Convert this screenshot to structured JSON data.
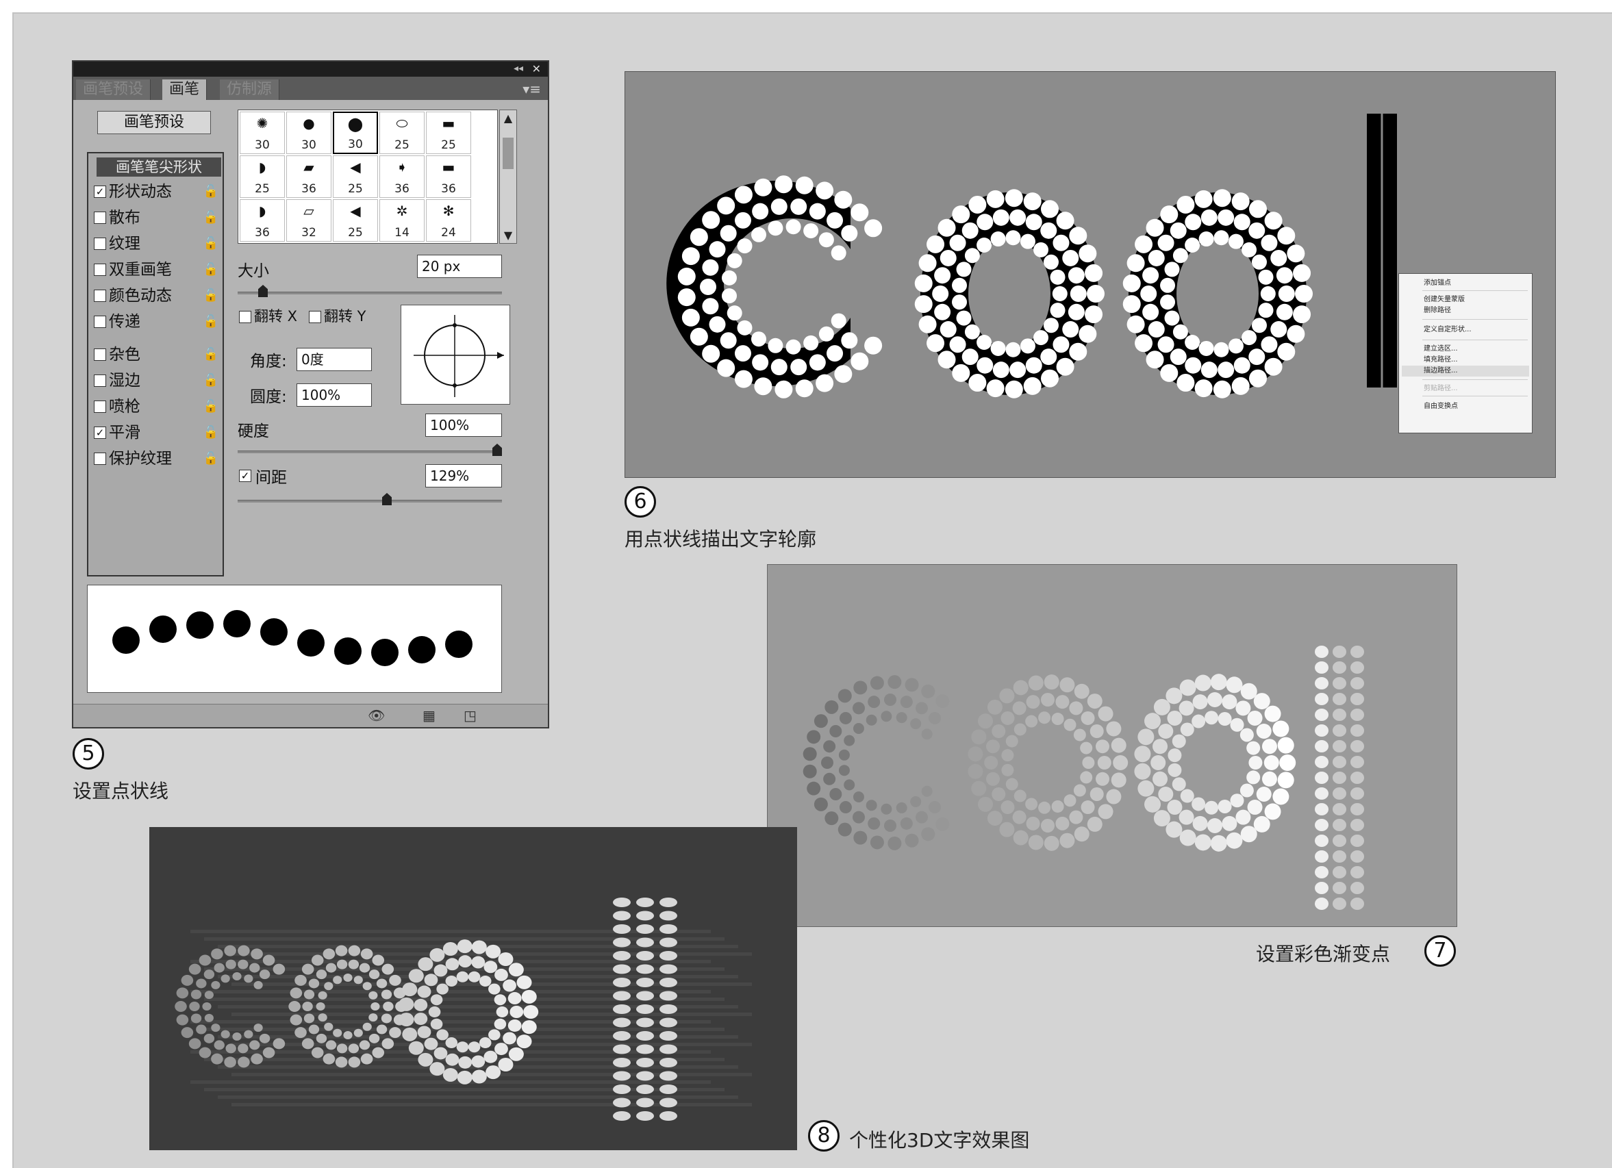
{
  "brush_panel": {
    "tabs": [
      "画笔预设",
      "画笔",
      "仿制源"
    ],
    "active_tab": 1,
    "preset_button": "画笔预设",
    "options_header": "画笔笔尖形状",
    "options": [
      {
        "label": "形状动态",
        "checked": true
      },
      {
        "label": "散布",
        "checked": false
      },
      {
        "label": "纹理",
        "checked": false
      },
      {
        "label": "双重画笔",
        "checked": false
      },
      {
        "label": "颜色动态",
        "checked": false
      },
      {
        "label": "传递",
        "checked": false
      },
      {
        "label": "杂色",
        "checked": false
      },
      {
        "label": "湿边",
        "checked": false
      },
      {
        "label": "喷枪",
        "checked": false
      },
      {
        "label": "平滑",
        "checked": true
      },
      {
        "label": "保护纹理",
        "checked": false
      }
    ],
    "tips": [
      {
        "size": "30"
      },
      {
        "size": "30"
      },
      {
        "size": "30",
        "selected": true
      },
      {
        "size": "25"
      },
      {
        "size": "25"
      },
      {
        "size": "25"
      },
      {
        "size": "36"
      },
      {
        "size": "25"
      },
      {
        "size": "36"
      },
      {
        "size": "36"
      },
      {
        "size": "36"
      },
      {
        "size": "32"
      },
      {
        "size": "25"
      },
      {
        "size": "14"
      },
      {
        "size": "24"
      }
    ],
    "size_label": "大小",
    "size_value": "20 px",
    "flip_x_label": "翻转 X",
    "flip_y_label": "翻转 Y",
    "angle_label": "角度:",
    "angle_value": "0度",
    "roundness_label": "圆度:",
    "roundness_value": "100%",
    "hardness_label": "硬度",
    "hardness_value": "100%",
    "spacing_label": "间距",
    "spacing_checked": true,
    "spacing_value": "129%"
  },
  "steps": [
    {
      "number": "5",
      "caption": "设置点状线"
    },
    {
      "number": "6",
      "caption": "用点状线描出文字轮廓"
    },
    {
      "number": "7",
      "caption": "设置彩色渐变点"
    },
    {
      "number": "8",
      "caption": "个性化3D文字效果图"
    }
  ],
  "context_menu": {
    "items": [
      {
        "label": "添加锚点",
        "disabled": false
      },
      {
        "label": "创建矢量蒙版",
        "disabled": false
      },
      {
        "label": "删除路径",
        "disabled": false
      },
      {
        "label": "定义自定形状...",
        "disabled": false
      },
      {
        "label": "建立选区...",
        "disabled": false
      },
      {
        "label": "填充路径...",
        "disabled": false
      },
      {
        "label": "描边路径...",
        "disabled": false,
        "highlighted": true
      },
      {
        "label": "剪贴路径...",
        "disabled": true
      },
      {
        "label": "自由变换点",
        "disabled": false
      }
    ]
  },
  "colors": {
    "page_bg": "#d4d4d4",
    "panel_bg": "#b4b4b4",
    "shot6_bg": "#8a8a8a",
    "shot7_bg": "#9a9a9a",
    "shot8_bg": "#3c3c3c"
  }
}
